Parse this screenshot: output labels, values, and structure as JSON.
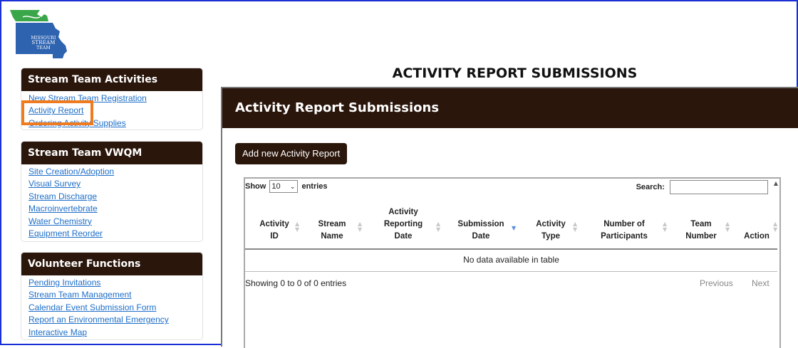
{
  "logo": {
    "line1": "MISSOURI",
    "line2": "STREAM",
    "line3": "TEAM"
  },
  "sidebar": {
    "sections": [
      {
        "title": "Stream Team Activities",
        "links": [
          "New Stream Team Registration",
          "Activity Report",
          "Ordering Activity Supplies"
        ]
      },
      {
        "title": "Stream Team VWQM",
        "links": [
          "Site Creation/Adoption",
          "Visual Survey",
          "Stream Discharge",
          "Macroinvertebrate",
          "Water Chemistry",
          "Equipment Reorder"
        ]
      },
      {
        "title": "Volunteer Functions",
        "links": [
          "Pending Invitations",
          "Stream Team Management",
          "Calendar Event Submission Form",
          "Report an Environmental Emergency",
          "Interactive Map"
        ]
      }
    ]
  },
  "main": {
    "page_title": "ACTIVITY REPORT SUBMISSIONS",
    "panel_title": "Activity Report Submissions",
    "add_button": "Add new Activity Report",
    "table": {
      "show_label": "Show",
      "page_size": "10",
      "entries_label": "entries",
      "search_label": "Search:",
      "columns": [
        {
          "line1": "Activity",
          "line2": "ID",
          "line3": ""
        },
        {
          "line1": "Stream",
          "line2": "Name",
          "line3": ""
        },
        {
          "line1": "Activity",
          "line2": "Reporting",
          "line3": "Date"
        },
        {
          "line1": "Submission",
          "line2": "Date",
          "line3": ""
        },
        {
          "line1": "Activity",
          "line2": "Type",
          "line3": ""
        },
        {
          "line1": "Number of",
          "line2": "Participants",
          "line3": ""
        },
        {
          "line1": "Team",
          "line2": "Number",
          "line3": ""
        },
        {
          "line1": "Action",
          "line2": "",
          "line3": ""
        }
      ],
      "empty_message": "No data available in table",
      "info": "Showing 0 to 0 of 0 entries",
      "previous": "Previous",
      "next": "Next"
    }
  },
  "colors": {
    "header_bg": "#2a160b",
    "link": "#1e6ec8",
    "highlight": "#f07b1f",
    "frame": "#1a2fd6",
    "logo_green": "#3aa64a",
    "logo_blue": "#2e63b0"
  }
}
